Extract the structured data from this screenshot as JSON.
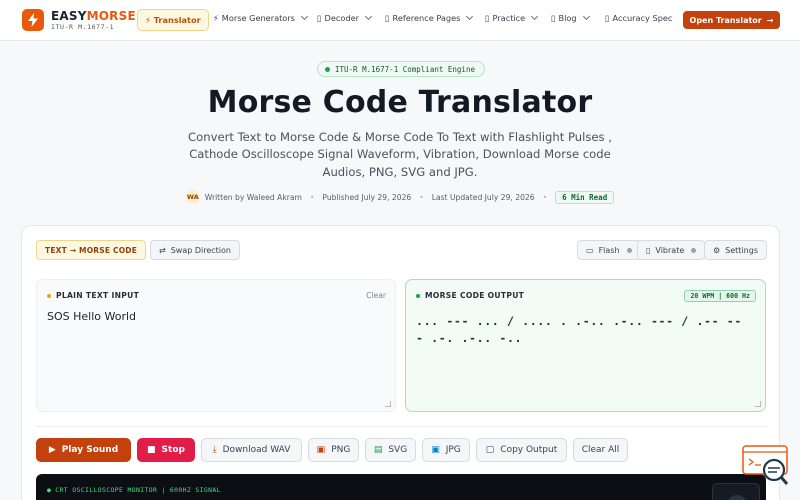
{
  "nav": {
    "logo_main": "EASY",
    "logo_accent": "MORSE",
    "logo_sub": "ITU-R M.1677-1",
    "items": [
      {
        "label": "Translator",
        "icon": "lightning-icon"
      },
      {
        "label": "Morse Generators",
        "icon": "lightning-icon"
      },
      {
        "label": "Decoder",
        "icon": "square-icon"
      },
      {
        "label": "Reference Pages",
        "icon": "square-icon"
      },
      {
        "label": "Practice",
        "icon": "square-icon"
      },
      {
        "label": "Blog",
        "icon": "square-icon"
      },
      {
        "label": "Accuracy Spec",
        "icon": "square-icon"
      }
    ],
    "cta": "Open Translator",
    "accent_color": "#c2410c"
  },
  "hero": {
    "badge": "ITU-R M.1677-1 Compliant Engine",
    "title": "Morse Code Translator",
    "description": "Convert Text to Morse Code & Morse Code To Text with Flashlight Pulses , Cathode Oscilloscope Signal Waveform, Vibration, Download Morse code Audios, PNG, SVG and JPG.",
    "author_initials": "WA",
    "author": "Written by Waleed Akram",
    "published": "Published July 29, 2026",
    "updated": "Last Updated July 29, 2026",
    "read_time": "6 Min Read"
  },
  "translator": {
    "direction": "TEXT → MORSE CODE",
    "swap": "Swap Direction",
    "flash": "Flash",
    "vibrate": "Vibrate",
    "settings": "Settings",
    "input_label": "PLAIN TEXT INPUT",
    "input_clear": "Clear",
    "input_value": "SOS Hello World",
    "output_label": "MORSE CODE OUTPUT",
    "wpm_badge": "20 WPM | 600 Hz",
    "output_value": "... --- ... / .... . .-.. .-.. --- / .-- --- .-. .-.. -..",
    "actions": {
      "play": "Play Sound",
      "stop": "Stop",
      "wav": "Download WAV",
      "png": "PNG",
      "svg": "SVG",
      "jpg": "JPG",
      "copy": "Copy Output",
      "clear_all": "Clear All"
    },
    "scope_label": "CRT OSCILLOSCOPE MONITOR | 600HZ SIGNAL"
  }
}
